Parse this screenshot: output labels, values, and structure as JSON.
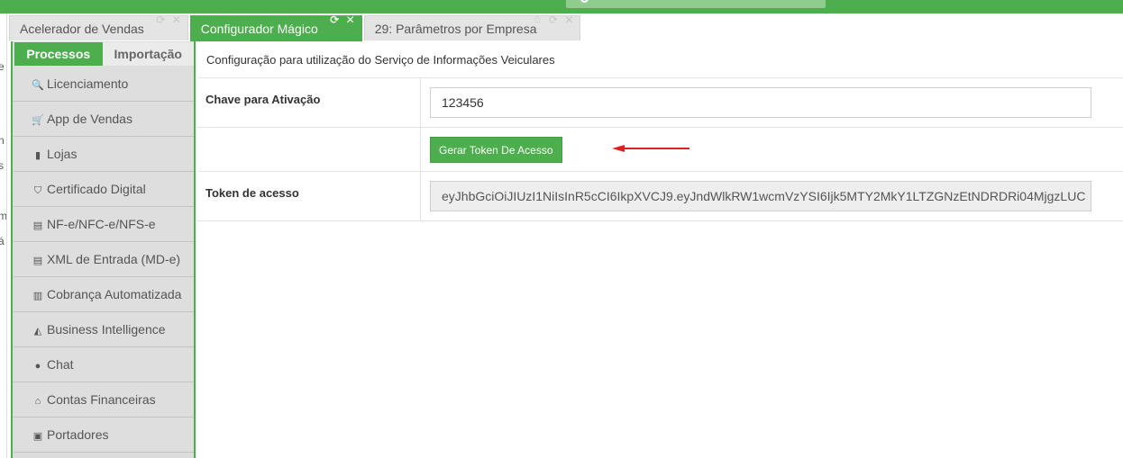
{
  "tabs": [
    {
      "label": "Acelerador de Vendas",
      "controls": "⟳ ✕"
    },
    {
      "label": "Configurador Mágico",
      "controls": "⟳ ✕"
    },
    {
      "label": "29: Parâmetros por Empresa",
      "controls": "☆ ⟳ ✕"
    }
  ],
  "sidebar": {
    "tab_processos": "Processos",
    "tab_importacao": "Importação",
    "items": [
      {
        "label": "Licenciamento",
        "icon": "🔍"
      },
      {
        "label": "App de Vendas",
        "icon": "🛒"
      },
      {
        "label": "Lojas",
        "icon": "▮"
      },
      {
        "label": "Certificado Digital",
        "icon": "⛉"
      },
      {
        "label": "NF-e/NFC-e/NFS-e",
        "icon": "▤"
      },
      {
        "label": "XML de Entrada (MD-e)",
        "icon": "▤"
      },
      {
        "label": "Cobrança Automatizada",
        "icon": "▥"
      },
      {
        "label": "Business Intelligence",
        "icon": "◭"
      },
      {
        "label": "Chat",
        "icon": "●"
      },
      {
        "label": "Contas Financeiras",
        "icon": "⌂"
      },
      {
        "label": "Portadores",
        "icon": "▣"
      }
    ]
  },
  "content": {
    "header": "Configuração para utilização do Serviço de Informações Veiculares",
    "activation_label": "Chave para Ativação",
    "activation_value": "123456",
    "generate_button": "Gerar Token De Acesso",
    "token_label": "Token de acesso",
    "token_value": "eyJhbGciOiJIUzI1NiIsInR5cCI6IkpXVCJ9.eyJndWlkRW1wcmVzYSI6Ijk5MTY2MkY1LTZGNzEtNDRDRi04MjgzLUC"
  },
  "colors": {
    "accent": "#4cae4c",
    "arrow": "#e02020"
  }
}
